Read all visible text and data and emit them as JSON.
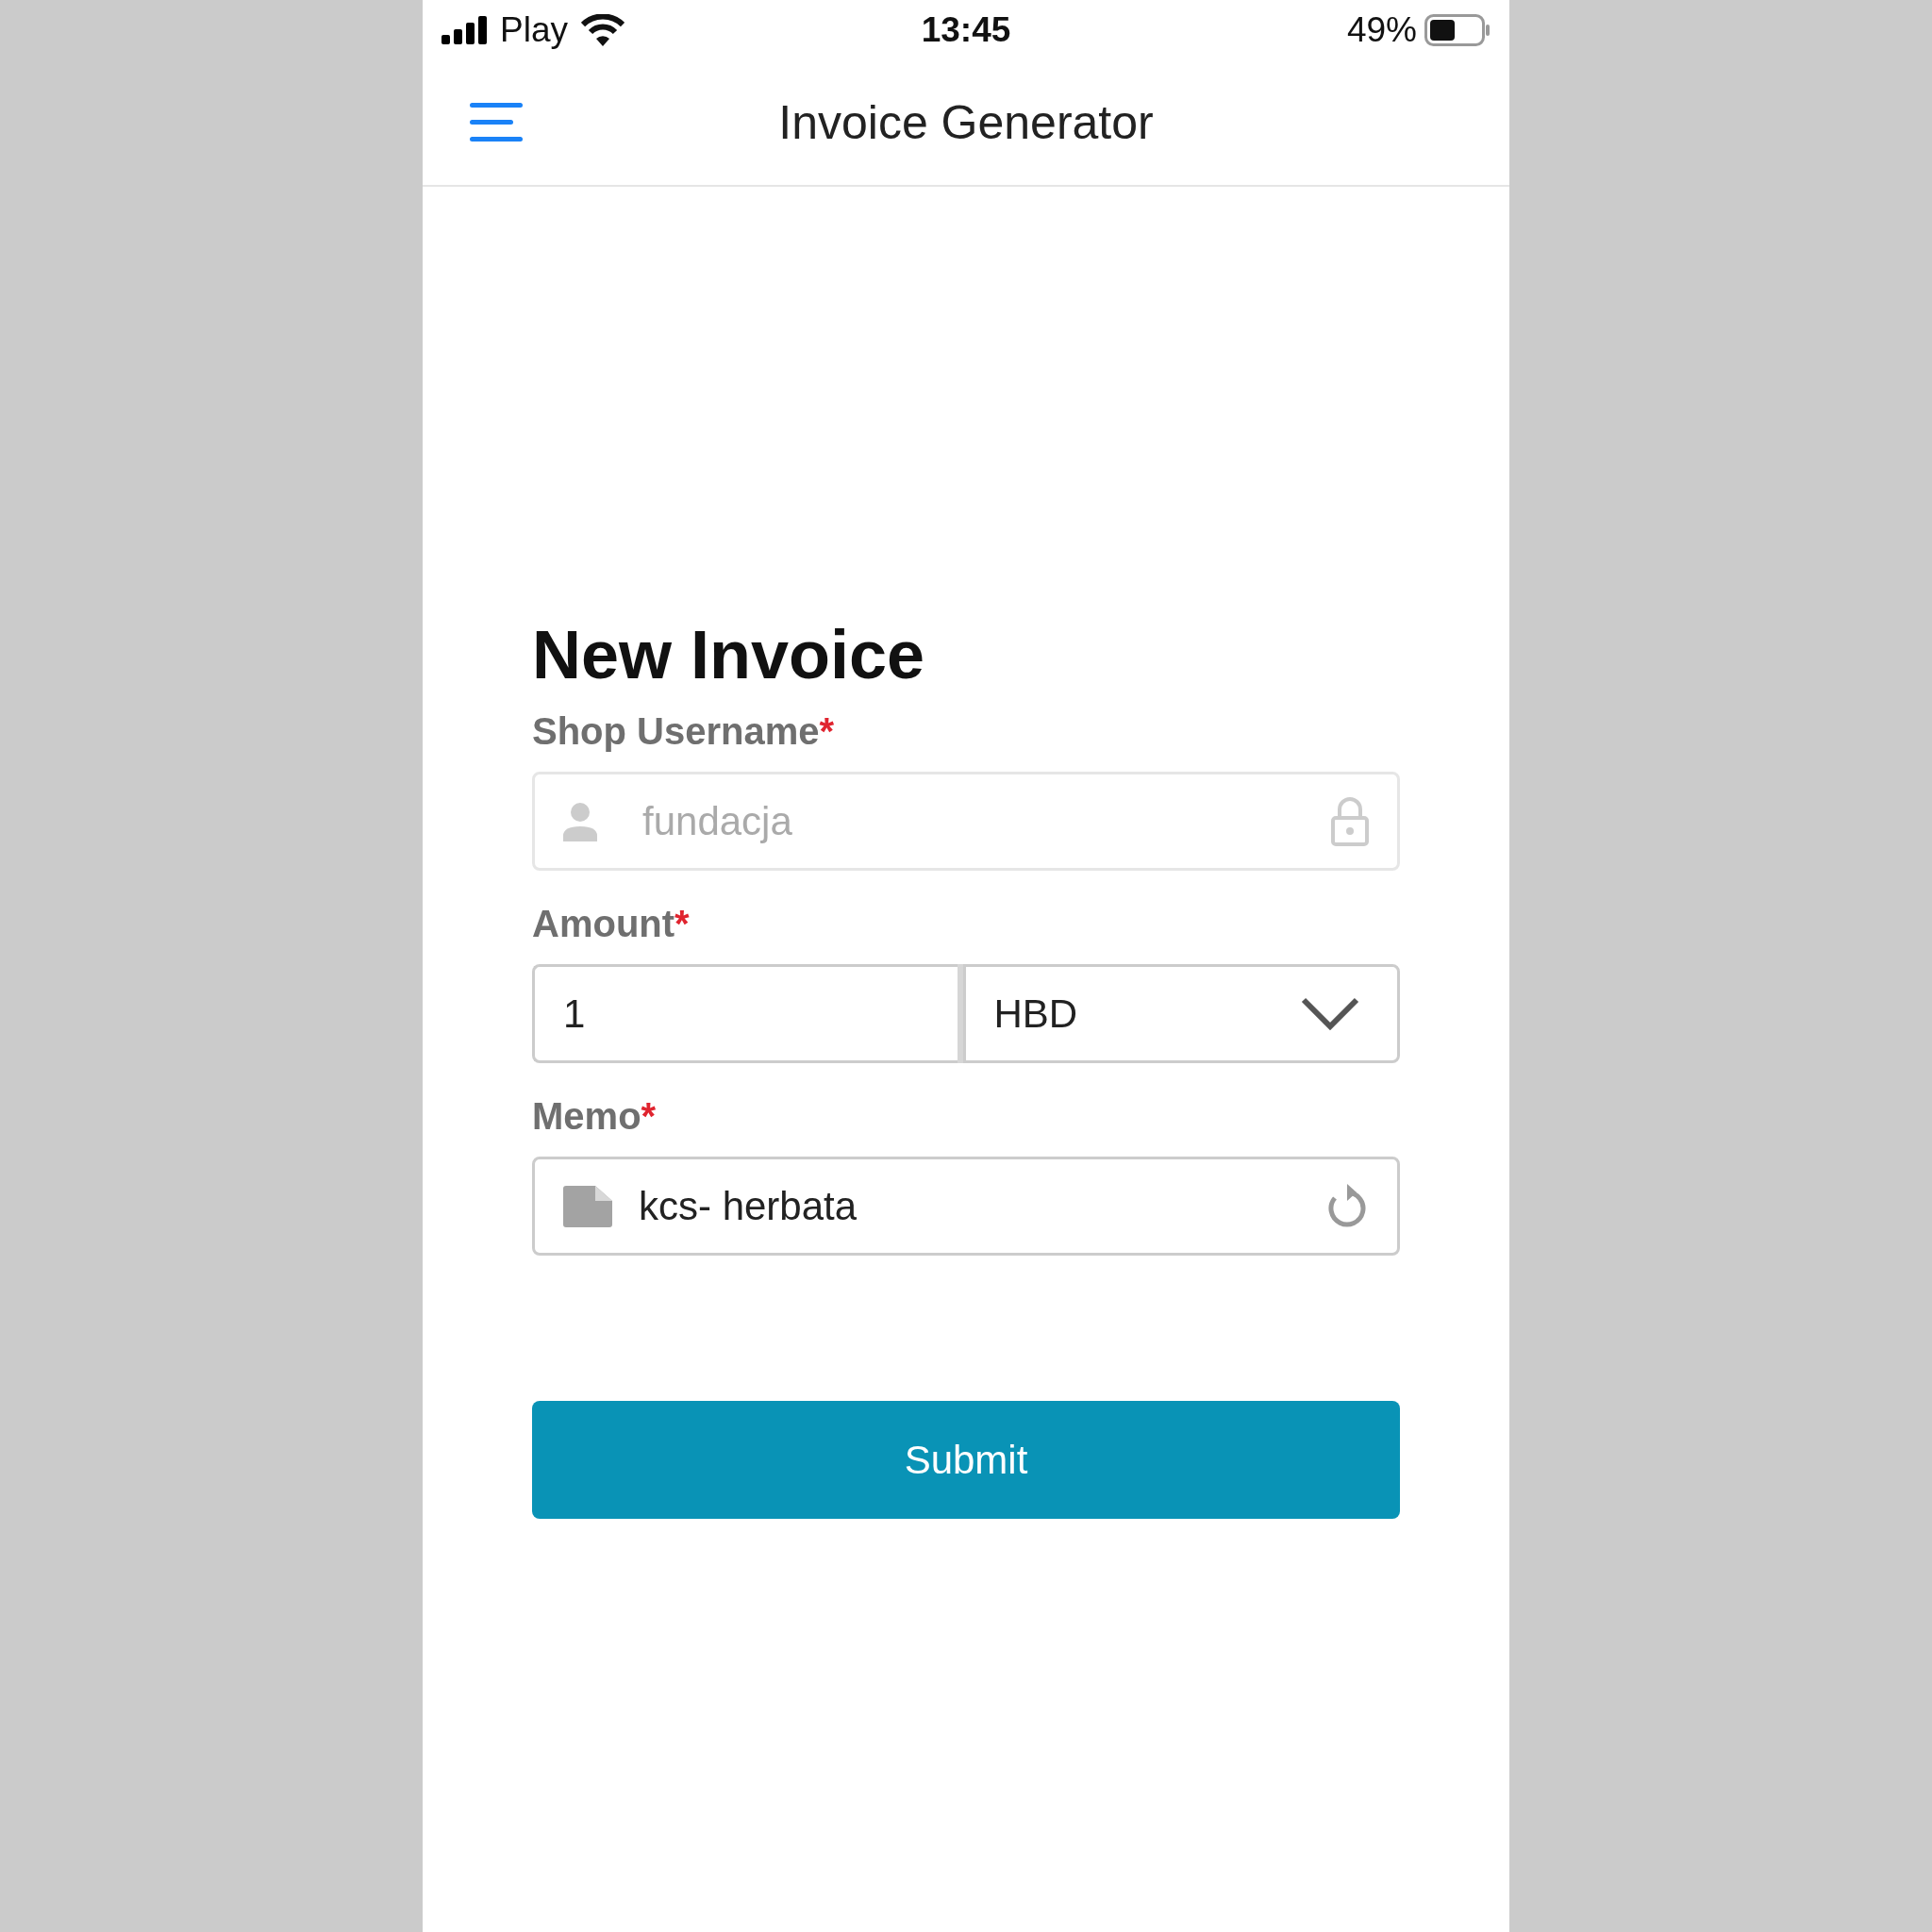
{
  "status_bar": {
    "carrier": "Play",
    "time": "13:45",
    "battery": "49%"
  },
  "header": {
    "title": "Invoice Generator"
  },
  "form": {
    "title": "New Invoice",
    "fields": [
      {
        "kind": "text",
        "label": "Shop Username",
        "required_mark": "*",
        "placeholder": "fundacja",
        "disabled": true
      },
      {
        "kind": "amount",
        "label": "Amount",
        "required_mark": "*",
        "value": "1",
        "currency": "HBD"
      },
      {
        "kind": "memo",
        "label": "Memo",
        "required_mark": "*",
        "value": "kcs- herbata"
      }
    ],
    "submit": "Submit"
  }
}
